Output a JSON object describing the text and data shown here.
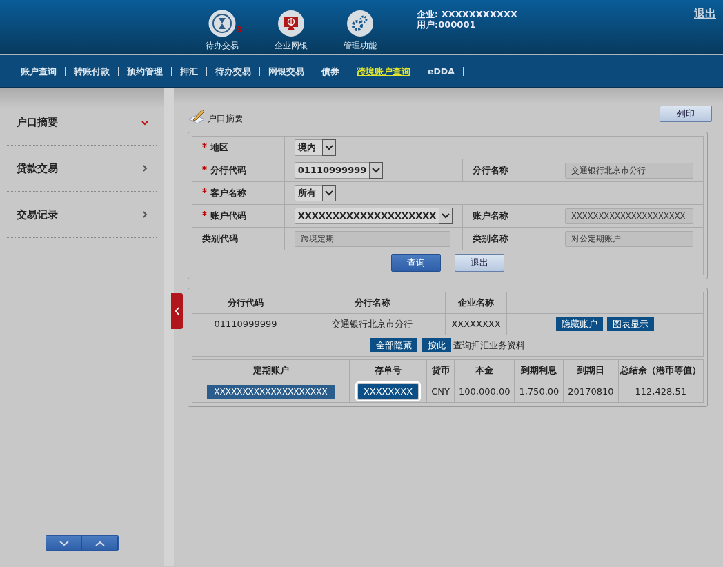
{
  "header": {
    "shortcuts": [
      {
        "kind": "pending",
        "label": "待办交易",
        "badge": "3"
      },
      {
        "kind": "ebank",
        "label": "企业网银"
      },
      {
        "kind": "admin",
        "label": "管理功能"
      }
    ],
    "company": "企业: XXXXXXXXXXX",
    "user": "用户:000001",
    "logout": "退出"
  },
  "nav": [
    {
      "label": "账户查询",
      "selected": false
    },
    {
      "label": "转账付款",
      "selected": false
    },
    {
      "label": "预约管理",
      "selected": false
    },
    {
      "label": "押汇",
      "selected": false
    },
    {
      "label": "待办交易",
      "selected": false
    },
    {
      "label": "网银交易",
      "selected": false
    },
    {
      "label": "债券",
      "selected": false
    },
    {
      "label": "跨境账户查询",
      "selected": true
    },
    {
      "label": "eDDA",
      "selected": false
    }
  ],
  "sidebar": {
    "items": [
      {
        "label": "户口摘要",
        "expanded": true
      },
      {
        "label": "贷款交易",
        "expanded": false
      },
      {
        "label": "交易记录",
        "expanded": false
      }
    ]
  },
  "page": {
    "title": "户口摘要",
    "print_button": "列印"
  },
  "form": {
    "rows": [
      [
        {
          "label": "地区",
          "required": true,
          "control": {
            "kind": "select",
            "value": "境内"
          }
        }
      ],
      [
        {
          "label": "分行代码",
          "required": true,
          "control": {
            "kind": "select",
            "value": "01110999999"
          }
        },
        {
          "label": "分行名称",
          "required": false,
          "control": {
            "kind": "readonly",
            "value": "交通银行北京市分行"
          }
        }
      ],
      [
        {
          "label": "客户名称",
          "required": true,
          "control": {
            "kind": "select",
            "value": "所有"
          }
        }
      ],
      [
        {
          "label": "账户代码",
          "required": true,
          "control": {
            "kind": "select",
            "value": "XXXXXXXXXXXXXXXXXXXX"
          }
        },
        {
          "label": "账户名称",
          "required": false,
          "control": {
            "kind": "readonly",
            "value": "XXXXXXXXXXXXXXXXXXXXX"
          }
        }
      ],
      [
        {
          "label": "类别代码",
          "required": false,
          "control": {
            "kind": "readonly",
            "value": "跨境定期"
          }
        },
        {
          "label": "类别名称",
          "required": false,
          "control": {
            "kind": "readonly",
            "value": "对公定期账户"
          }
        }
      ]
    ],
    "buttons": [
      {
        "label": "查询",
        "kind": "primary"
      },
      {
        "label": "退出",
        "kind": "secondary"
      }
    ]
  },
  "summary": {
    "columns": [
      "分行代码",
      "分行名称",
      "企业名称"
    ],
    "row": [
      "01110999999",
      "交通银行北京市分行",
      "XXXXXXXX"
    ],
    "row_buttons": [
      "隐藏账户",
      "图表显示"
    ],
    "bar_buttons": [
      "全部隐藏",
      "按此"
    ],
    "bar_note": "查询押汇业务资料"
  },
  "deposits": {
    "columns": [
      "定期账户",
      "存单号",
      "货币",
      "本金",
      "到期利息",
      "到期日",
      "总结余（港币等值）"
    ],
    "rows": [
      {
        "certificate_focused": true,
        "cells": [
          "XXXXXXXXXXXXXXXXXXXX",
          "XXXXXXXX",
          "CNY",
          "100,000.00",
          "1,750.00",
          "20170810",
          "112,428.51"
        ]
      }
    ]
  }
}
